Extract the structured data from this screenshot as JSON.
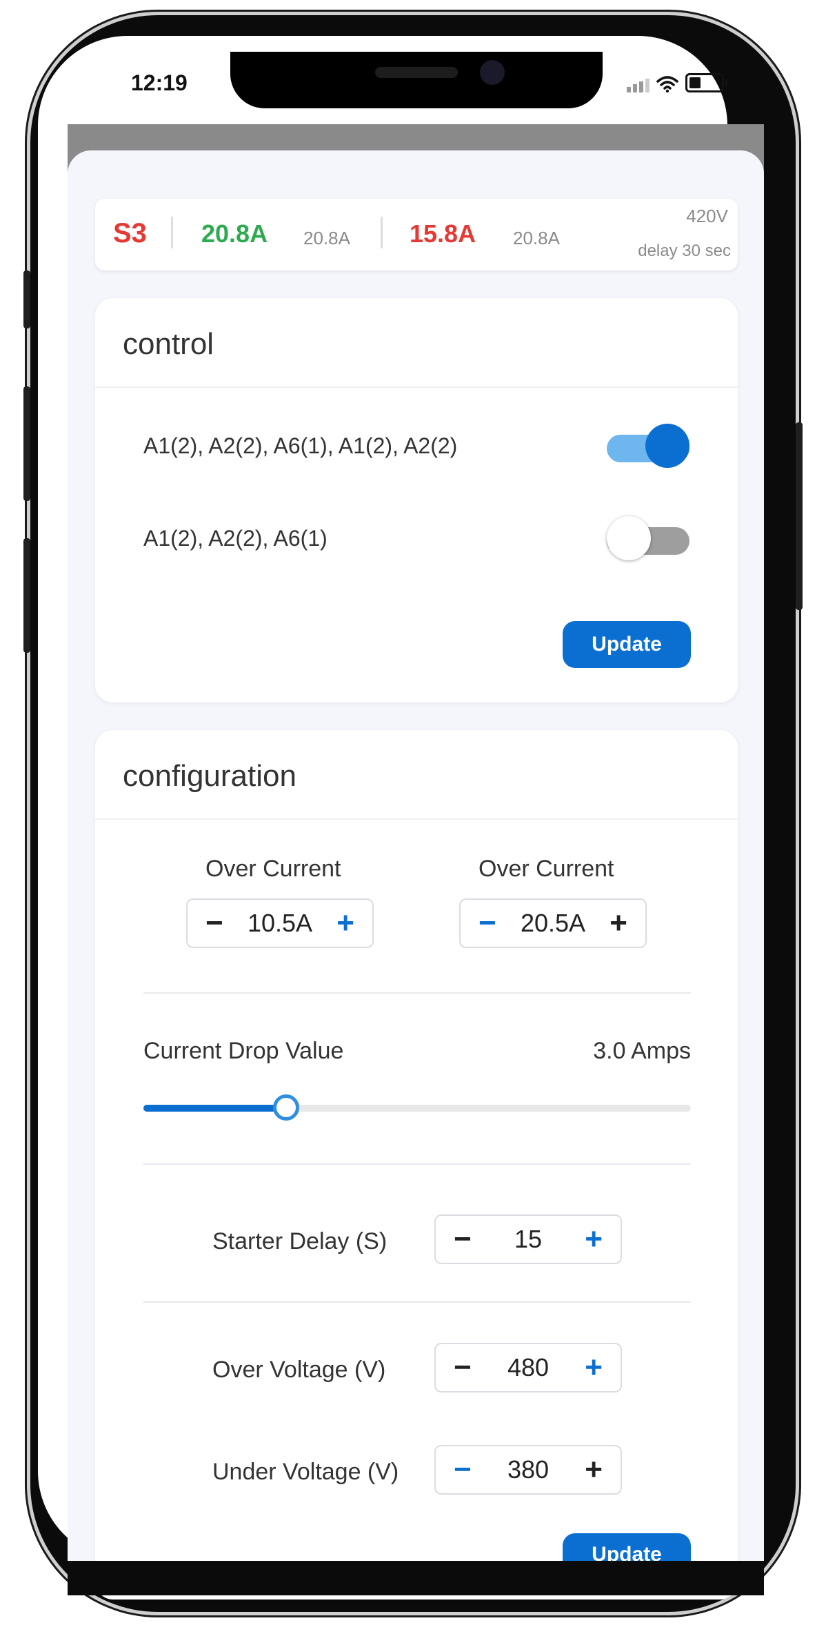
{
  "status_bar": {
    "time": "12:19"
  },
  "summary": {
    "station": "S3",
    "current_1": "20.8A",
    "current_1_ref": "20.8A",
    "current_2": "15.8A",
    "current_2_ref": "20.8A",
    "voltage": "420V",
    "delay": "delay 30 sec",
    "colors": {
      "station": "#e53935",
      "current_1": "#2eaa4f",
      "current_2": "#e53935"
    }
  },
  "control": {
    "title": "control",
    "items": [
      {
        "label": "A1(2), A2(2), A6(1), A1(2), A2(2)",
        "on": true
      },
      {
        "label": "A1(2), A2(2), A6(1)",
        "on": false
      }
    ],
    "update_label": "Update"
  },
  "configuration": {
    "title": "configuration",
    "over_current_1": {
      "label": "Over Current",
      "value": "10.5A"
    },
    "over_current_2": {
      "label": "Over Current",
      "value": "20.5A"
    },
    "current_drop": {
      "label": "Current Drop Value",
      "value": "3.0 Amps",
      "fraction": 0.26
    },
    "starter_delay": {
      "label": "Starter Delay (S)",
      "value": "15"
    },
    "over_voltage": {
      "label": "Over Voltage (V)",
      "value": "480"
    },
    "under_voltage": {
      "label": "Under Voltage (V)",
      "value": "380"
    },
    "update_label": "Update"
  },
  "accent_color": "#0b6fd1",
  "icons": [
    "minus-icon",
    "plus-icon",
    "signal-icon",
    "wifi-icon",
    "battery-icon"
  ]
}
